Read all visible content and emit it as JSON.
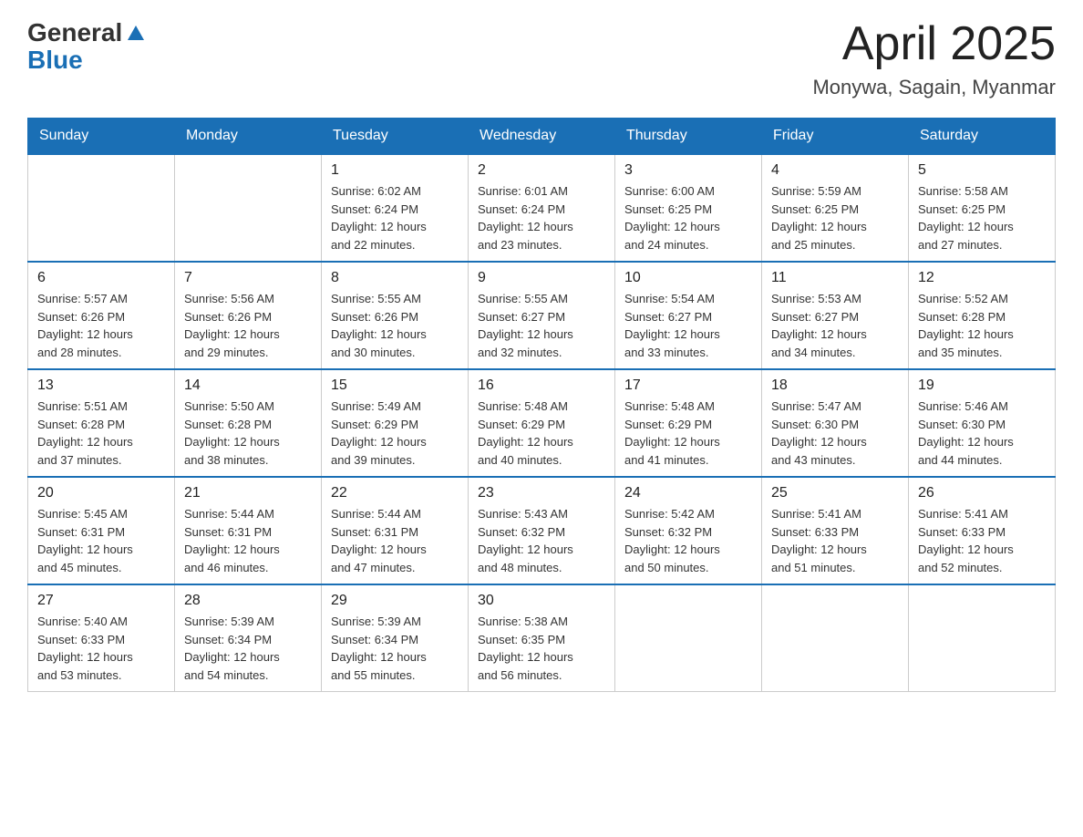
{
  "logo": {
    "text_general": "General",
    "text_blue": "Blue"
  },
  "title": {
    "month_year": "April 2025",
    "location": "Monywa, Sagain, Myanmar"
  },
  "weekdays": [
    "Sunday",
    "Monday",
    "Tuesday",
    "Wednesday",
    "Thursday",
    "Friday",
    "Saturday"
  ],
  "weeks": [
    [
      {
        "day": "",
        "info": ""
      },
      {
        "day": "",
        "info": ""
      },
      {
        "day": "1",
        "info": "Sunrise: 6:02 AM\nSunset: 6:24 PM\nDaylight: 12 hours\nand 22 minutes."
      },
      {
        "day": "2",
        "info": "Sunrise: 6:01 AM\nSunset: 6:24 PM\nDaylight: 12 hours\nand 23 minutes."
      },
      {
        "day": "3",
        "info": "Sunrise: 6:00 AM\nSunset: 6:25 PM\nDaylight: 12 hours\nand 24 minutes."
      },
      {
        "day": "4",
        "info": "Sunrise: 5:59 AM\nSunset: 6:25 PM\nDaylight: 12 hours\nand 25 minutes."
      },
      {
        "day": "5",
        "info": "Sunrise: 5:58 AM\nSunset: 6:25 PM\nDaylight: 12 hours\nand 27 minutes."
      }
    ],
    [
      {
        "day": "6",
        "info": "Sunrise: 5:57 AM\nSunset: 6:26 PM\nDaylight: 12 hours\nand 28 minutes."
      },
      {
        "day": "7",
        "info": "Sunrise: 5:56 AM\nSunset: 6:26 PM\nDaylight: 12 hours\nand 29 minutes."
      },
      {
        "day": "8",
        "info": "Sunrise: 5:55 AM\nSunset: 6:26 PM\nDaylight: 12 hours\nand 30 minutes."
      },
      {
        "day": "9",
        "info": "Sunrise: 5:55 AM\nSunset: 6:27 PM\nDaylight: 12 hours\nand 32 minutes."
      },
      {
        "day": "10",
        "info": "Sunrise: 5:54 AM\nSunset: 6:27 PM\nDaylight: 12 hours\nand 33 minutes."
      },
      {
        "day": "11",
        "info": "Sunrise: 5:53 AM\nSunset: 6:27 PM\nDaylight: 12 hours\nand 34 minutes."
      },
      {
        "day": "12",
        "info": "Sunrise: 5:52 AM\nSunset: 6:28 PM\nDaylight: 12 hours\nand 35 minutes."
      }
    ],
    [
      {
        "day": "13",
        "info": "Sunrise: 5:51 AM\nSunset: 6:28 PM\nDaylight: 12 hours\nand 37 minutes."
      },
      {
        "day": "14",
        "info": "Sunrise: 5:50 AM\nSunset: 6:28 PM\nDaylight: 12 hours\nand 38 minutes."
      },
      {
        "day": "15",
        "info": "Sunrise: 5:49 AM\nSunset: 6:29 PM\nDaylight: 12 hours\nand 39 minutes."
      },
      {
        "day": "16",
        "info": "Sunrise: 5:48 AM\nSunset: 6:29 PM\nDaylight: 12 hours\nand 40 minutes."
      },
      {
        "day": "17",
        "info": "Sunrise: 5:48 AM\nSunset: 6:29 PM\nDaylight: 12 hours\nand 41 minutes."
      },
      {
        "day": "18",
        "info": "Sunrise: 5:47 AM\nSunset: 6:30 PM\nDaylight: 12 hours\nand 43 minutes."
      },
      {
        "day": "19",
        "info": "Sunrise: 5:46 AM\nSunset: 6:30 PM\nDaylight: 12 hours\nand 44 minutes."
      }
    ],
    [
      {
        "day": "20",
        "info": "Sunrise: 5:45 AM\nSunset: 6:31 PM\nDaylight: 12 hours\nand 45 minutes."
      },
      {
        "day": "21",
        "info": "Sunrise: 5:44 AM\nSunset: 6:31 PM\nDaylight: 12 hours\nand 46 minutes."
      },
      {
        "day": "22",
        "info": "Sunrise: 5:44 AM\nSunset: 6:31 PM\nDaylight: 12 hours\nand 47 minutes."
      },
      {
        "day": "23",
        "info": "Sunrise: 5:43 AM\nSunset: 6:32 PM\nDaylight: 12 hours\nand 48 minutes."
      },
      {
        "day": "24",
        "info": "Sunrise: 5:42 AM\nSunset: 6:32 PM\nDaylight: 12 hours\nand 50 minutes."
      },
      {
        "day": "25",
        "info": "Sunrise: 5:41 AM\nSunset: 6:33 PM\nDaylight: 12 hours\nand 51 minutes."
      },
      {
        "day": "26",
        "info": "Sunrise: 5:41 AM\nSunset: 6:33 PM\nDaylight: 12 hours\nand 52 minutes."
      }
    ],
    [
      {
        "day": "27",
        "info": "Sunrise: 5:40 AM\nSunset: 6:33 PM\nDaylight: 12 hours\nand 53 minutes."
      },
      {
        "day": "28",
        "info": "Sunrise: 5:39 AM\nSunset: 6:34 PM\nDaylight: 12 hours\nand 54 minutes."
      },
      {
        "day": "29",
        "info": "Sunrise: 5:39 AM\nSunset: 6:34 PM\nDaylight: 12 hours\nand 55 minutes."
      },
      {
        "day": "30",
        "info": "Sunrise: 5:38 AM\nSunset: 6:35 PM\nDaylight: 12 hours\nand 56 minutes."
      },
      {
        "day": "",
        "info": ""
      },
      {
        "day": "",
        "info": ""
      },
      {
        "day": "",
        "info": ""
      }
    ]
  ]
}
